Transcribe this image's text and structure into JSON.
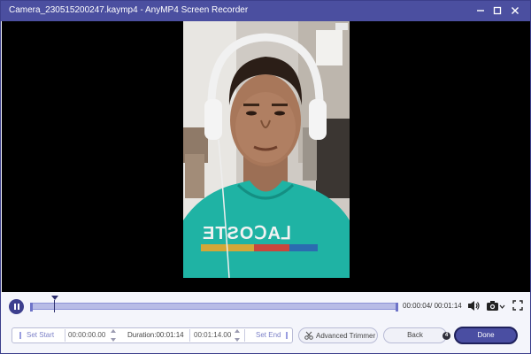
{
  "window": {
    "title": "Camera_230515200247.kaymp4  -  AnyMP4 Screen Recorder",
    "minimize_icon": "minimize-icon",
    "maximize_icon": "maximize-icon",
    "close_icon": "close-icon"
  },
  "video": {
    "shirt_text": "LACOSTE",
    "shirt_text_mirrored": "ƎTƧOↃA⅃"
  },
  "playback": {
    "play_state_icon": "pause-icon",
    "position": "00:00:04",
    "duration": "00:01:14",
    "time_readout": "00:00:04/ 00:01:14",
    "progress_fraction": 0.06,
    "volume_icon": "speaker-icon",
    "snapshot_icon": "camera-icon",
    "fullscreen_icon": "fullscreen-icon"
  },
  "trim": {
    "set_start_label": "Set Start",
    "start_time": "00:00:00.00",
    "duration_label": "Duration:00:01:14",
    "end_time": "00:01:14.00",
    "set_end_label": "Set End"
  },
  "buttons": {
    "advanced_trimmer": "Advanced Trimmer",
    "back": "Back",
    "step_badge": "4",
    "done": "Done"
  },
  "colors": {
    "title_bar": "#4b4fa0",
    "accent": "#4a4ea2",
    "track": "#b8bce6"
  }
}
